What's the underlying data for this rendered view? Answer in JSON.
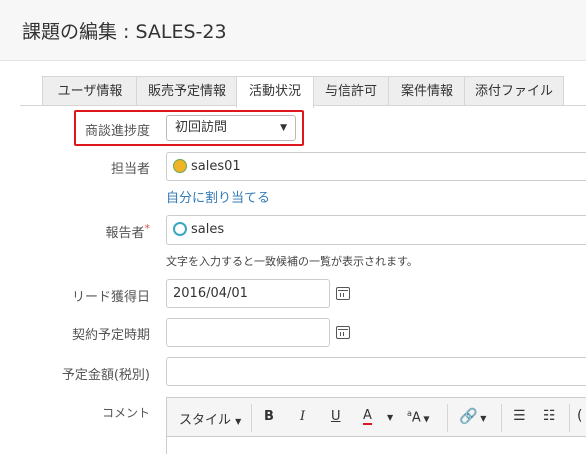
{
  "header": {
    "title": "課題の編集 : SALES-23"
  },
  "tabs": [
    {
      "label": "ユーザ情報",
      "active": false
    },
    {
      "label": "販売予定情報",
      "active": false
    },
    {
      "label": "活動状況",
      "active": true
    },
    {
      "label": "与信許可",
      "active": false
    },
    {
      "label": "案件情報",
      "active": false
    },
    {
      "label": "添付ファイル",
      "active": false
    }
  ],
  "form": {
    "negotiation": {
      "label": "商談進捗度",
      "value": "初回訪問"
    },
    "assignee": {
      "label": "担当者",
      "value": "sales01",
      "assign_self": "自分に割り当てる"
    },
    "reporter": {
      "label": "報告者",
      "required_mark": "*",
      "value": "sales",
      "hint": "文字を入力すると一致候補の一覧が表示されます。"
    },
    "lead_date": {
      "label": "リード獲得日",
      "value": "2016/04/01"
    },
    "contract_date": {
      "label": "契約予定時期",
      "value": ""
    },
    "amount": {
      "label": "予定金額(税別)",
      "value": ""
    },
    "comment": {
      "label": "コメント"
    }
  },
  "toolbar": {
    "style_label": "スタイル",
    "bold": "B",
    "italic": "I",
    "underline": "U",
    "text_color": "A",
    "text_color_accent": "#e0161e",
    "font_size": "A"
  },
  "colors": {
    "highlight": "#e0161e",
    "link": "#337ab7",
    "required": "#d9534f"
  }
}
